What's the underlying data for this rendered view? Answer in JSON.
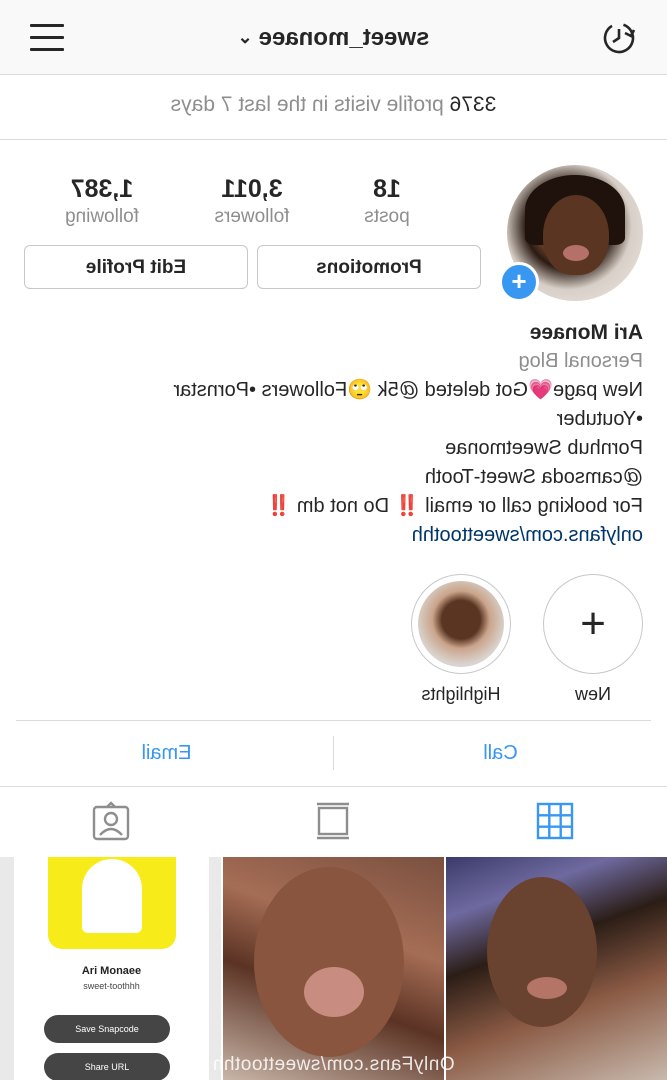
{
  "header": {
    "username": "sweet_monaee",
    "chevron_icon": "chevron-down-icon",
    "history_icon": "history-icon",
    "menu_icon": "menu-icon"
  },
  "insights": {
    "visits_count": "3376",
    "visits_text": "profile visits in the last 7 days"
  },
  "stats": {
    "posts": {
      "value": "18",
      "label": "posts"
    },
    "followers": {
      "value": "3,011",
      "label": "followers"
    },
    "following": {
      "value": "1,387",
      "label": "following"
    }
  },
  "buttons": {
    "promotions": "Promotions",
    "edit_profile": "Edit Profile"
  },
  "bio": {
    "name": "Ari Monaee",
    "category": "Personal Blog",
    "lines": [
      "New page💗Got deleted @5k 🙄Followers •Pornstar",
      "•Youtuber",
      "Pornhub Sweetmonae",
      "@camsoda Sweet-Tooth",
      "For booking call or email ‼️ Do not dm ‼️"
    ],
    "link": "onlyfans.com/sweettoothh"
  },
  "highlights": [
    {
      "label": "New",
      "icon": "plus-icon"
    },
    {
      "label": "Highlights",
      "icon": "highlight-cover"
    }
  ],
  "contact": {
    "call": "Call",
    "email": "Email"
  },
  "tabs": [
    {
      "name": "grid",
      "icon": "grid-icon",
      "active": true
    },
    {
      "name": "feed",
      "icon": "feed-icon",
      "active": false
    },
    {
      "name": "tagged",
      "icon": "tagged-icon",
      "active": false
    }
  ],
  "posts": {
    "snapcode_post": {
      "name": "Ari Monaee",
      "user": "sweet-toothhh",
      "save_label": "Save Snapcode",
      "share_label": "Share URL"
    },
    "watermark": "OnlyFans.com/sweettoothh"
  },
  "colors": {
    "accent": "#3897f0",
    "link": "#003569",
    "muted": "#8e8e8e",
    "snap_yellow": "#f7ec1a"
  }
}
